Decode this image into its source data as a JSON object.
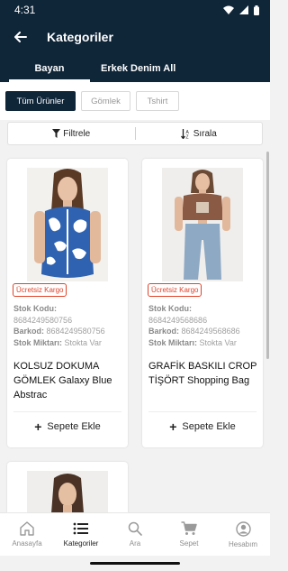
{
  "status_bar": {
    "time": "4:31"
  },
  "app_bar": {
    "title": "Kategoriler"
  },
  "tabs": [
    {
      "label": "Bayan",
      "active": true
    },
    {
      "label": "Erkek Denim All",
      "active": false
    }
  ],
  "chips": [
    {
      "label": "Tüm Ürünler",
      "active": true
    },
    {
      "label": "Gömlek",
      "active": false
    },
    {
      "label": "Tshirt",
      "active": false
    }
  ],
  "toolbar": {
    "filter_label": "Filtrele",
    "sort_label": "Sırala"
  },
  "products": [
    {
      "badge": "Ücretsiz Kargo",
      "stock_code_label": "Stok Kodu:",
      "stock_code": "8684249580756",
      "barcode_label": "Barkod:",
      "barcode": "8684249580756",
      "stock_qty_label": "Stok Miktarı:",
      "stock_qty": "Stokta Var",
      "name": "KOLSUZ DOKUMA GÖMLEK Galaxy Blue Abstrac",
      "add_label": "Sepete Ekle"
    },
    {
      "badge": "Ücretsiz Kargo",
      "stock_code_label": "Stok Kodu:",
      "stock_code": "8684249568686",
      "barcode_label": "Barkod:",
      "barcode": "8684249568686",
      "stock_qty_label": "Stok Miktarı:",
      "stock_qty": "Stokta Var",
      "name": "GRAFİK BASKILI CROP TİŞÖRT Shopping Bag",
      "add_label": "Sepete Ekle"
    }
  ],
  "bottom_nav": [
    {
      "label": "Anasayfa",
      "icon": "home-icon",
      "active": false
    },
    {
      "label": "Kategoriler",
      "icon": "list-icon",
      "active": true
    },
    {
      "label": "Ara",
      "icon": "search-icon",
      "active": false
    },
    {
      "label": "Sepet",
      "icon": "cart-icon",
      "active": false
    },
    {
      "label": "Hesabım",
      "icon": "account-icon",
      "active": false
    }
  ],
  "colors": {
    "primary": "#0f2538",
    "badge": "#e0432a",
    "background": "#f2f2f2"
  }
}
